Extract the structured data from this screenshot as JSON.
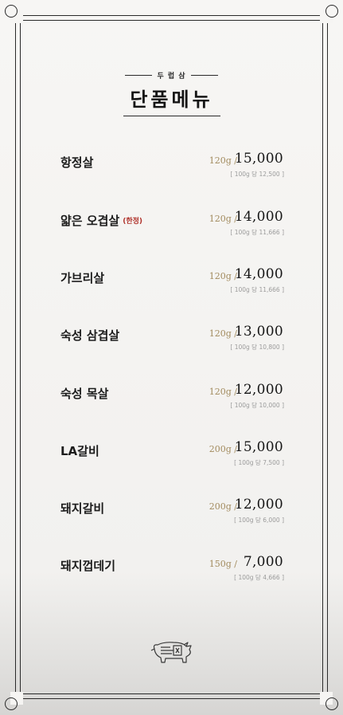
{
  "header": {
    "brand": "두 럽 삼",
    "title": "단품메뉴"
  },
  "menu": [
    {
      "name": "항정살",
      "tag": "",
      "weight": "120g /",
      "price": "15,000",
      "unit": "[ 100g 당 12,500 ]"
    },
    {
      "name": "얇은 오겹살",
      "tag": "(한정)",
      "weight": "120g /",
      "price": "14,000",
      "unit": "[ 100g 당 11,666 ]"
    },
    {
      "name": "가브리살",
      "tag": "",
      "weight": "120g /",
      "price": "14,000",
      "unit": "[ 100g 당 11,666 ]"
    },
    {
      "name": "숙성 삼겹살",
      "tag": "",
      "weight": "120g /",
      "price": "13,000",
      "unit": "[ 100g 당 10,800 ]"
    },
    {
      "name": "숙성 목살",
      "tag": "",
      "weight": "120g /",
      "price": "12,000",
      "unit": "[ 100g 당 10,000 ]"
    },
    {
      "name": "LA갈비",
      "tag": "",
      "weight": "200g /",
      "price": "15,000",
      "unit": "[ 100g 당 7,500 ]"
    },
    {
      "name": "돼지갈비",
      "tag": "",
      "weight": "200g /",
      "price": "12,000",
      "unit": "[ 100g 당 6,000 ]"
    },
    {
      "name": "돼지껍데기",
      "tag": "",
      "weight": "150g /",
      "price": "7,000",
      "unit": "[ 100g 당 4,666 ]"
    }
  ],
  "colors": {
    "accent_tag": "#b0332c",
    "weight": "#a28b5e",
    "frame": "#2a2a2a"
  },
  "footer": {
    "logo_icon": "pig-logo-icon"
  }
}
